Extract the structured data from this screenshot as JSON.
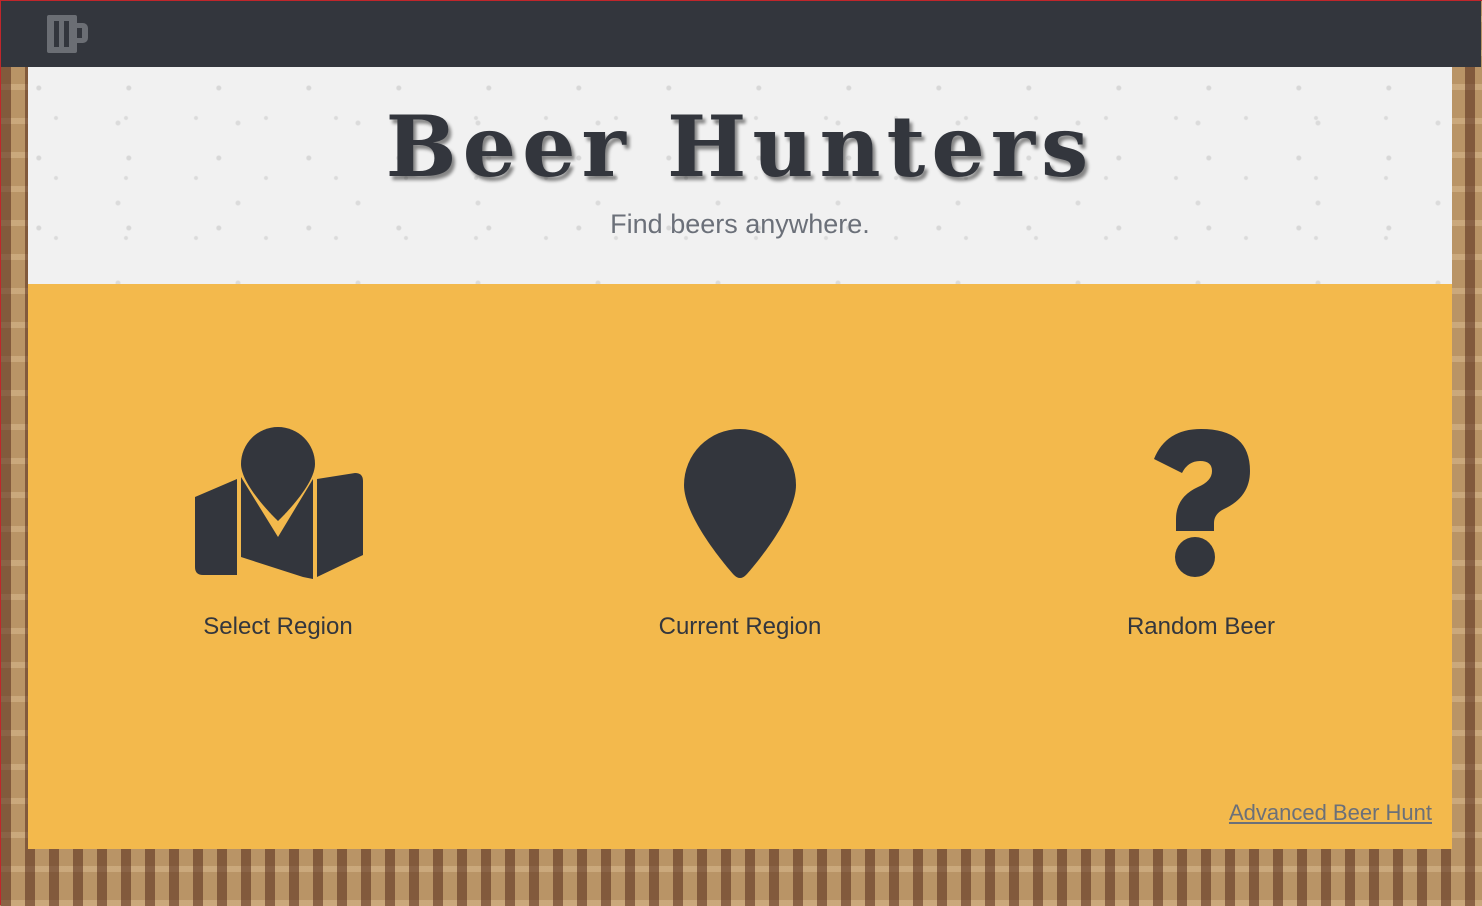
{
  "app": {
    "title": "Beer Hunters",
    "tagline": "Find beers anywhere."
  },
  "topbar": {
    "logo_icon": "beer-mug-icon"
  },
  "options": [
    {
      "label": "Select Region",
      "icon": "map-marker-icon"
    },
    {
      "label": "Current Region",
      "icon": "location-pin-icon"
    },
    {
      "label": "Random Beer",
      "icon": "question-mark-icon"
    }
  ],
  "links": {
    "advanced": "Advanced Beer Hunt"
  },
  "colors": {
    "topbar": "#33363d",
    "accent": "#f3b94c",
    "hero_bg": "#f1f1f1",
    "icon": "#33363d",
    "muted_text": "#6b7079"
  }
}
